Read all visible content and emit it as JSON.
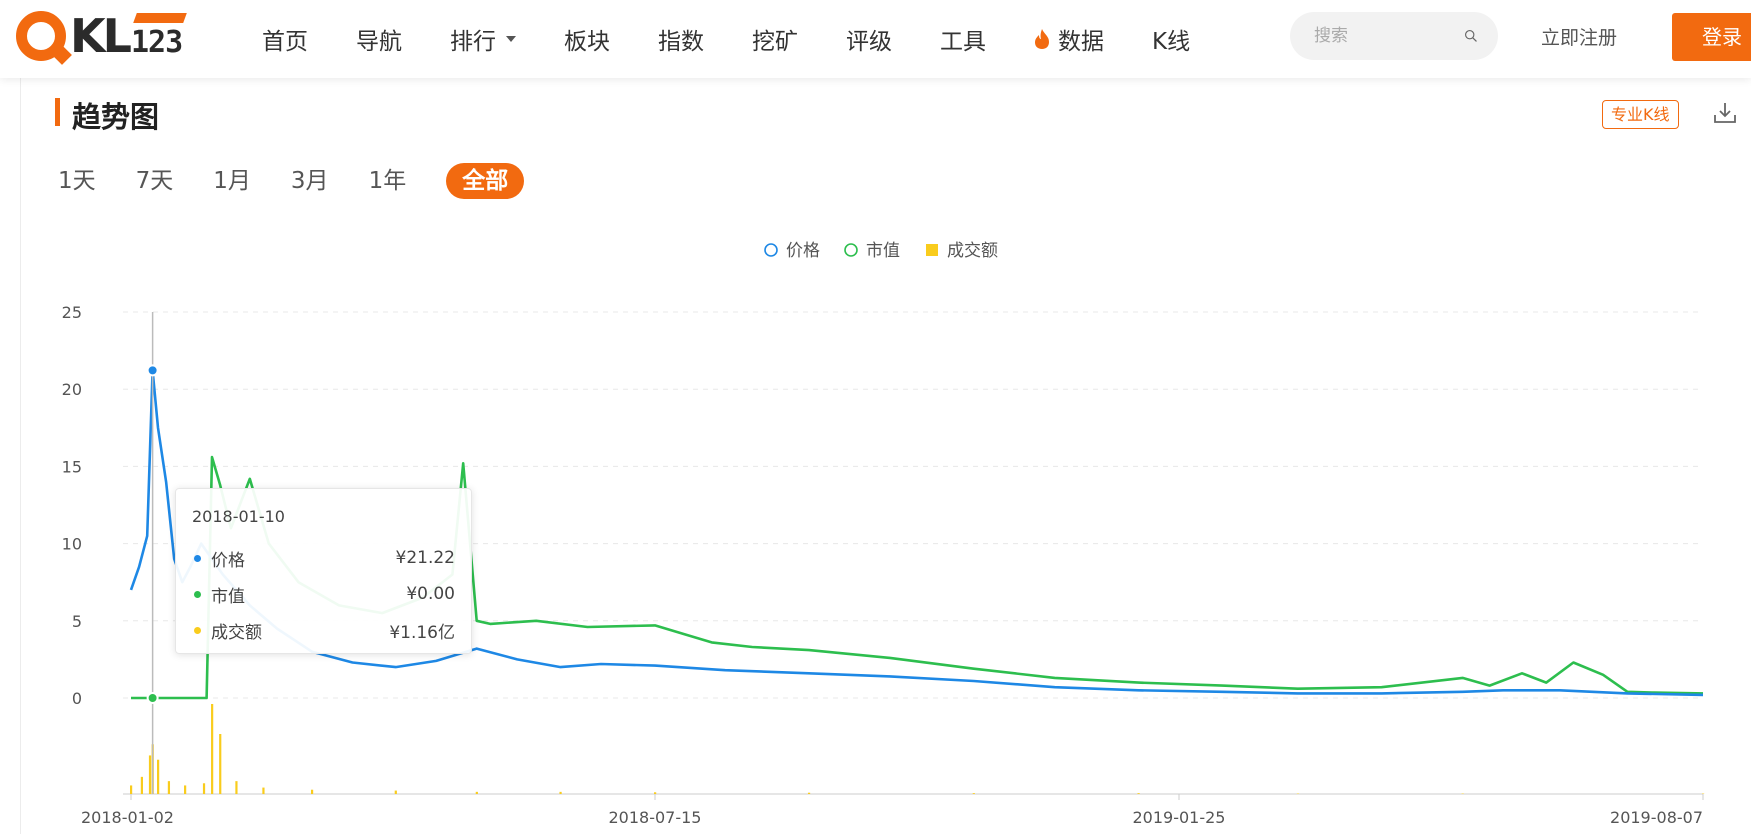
{
  "header": {
    "logo_letters": "KL",
    "logo_number": "123",
    "nav": [
      {
        "label": "首页"
      },
      {
        "label": "导航"
      },
      {
        "label": "排行",
        "dropdown": true
      },
      {
        "label": "板块"
      },
      {
        "label": "指数"
      },
      {
        "label": "挖矿"
      },
      {
        "label": "评级"
      },
      {
        "label": "工具"
      },
      {
        "label": "数据",
        "icon": "flame-icon"
      },
      {
        "label": "K线"
      }
    ],
    "search_placeholder": "搜索",
    "register": "立即注册",
    "login": "登录"
  },
  "section": {
    "title": "趋势图",
    "pro_kline": "专业K线",
    "ranges": [
      "1天",
      "7天",
      "1月",
      "3月",
      "1年",
      "全部"
    ],
    "active_range": "全部"
  },
  "tooltip": {
    "date": "2018-01-10",
    "rows": [
      {
        "name": "价格",
        "value": "¥21.22",
        "color": "#1e88e5"
      },
      {
        "name": "市值",
        "value": "¥0.00",
        "color": "#2dbe4e"
      },
      {
        "name": "成交额",
        "value": "¥1.16亿",
        "color": "#f9cc1d"
      }
    ]
  },
  "colors": {
    "accent": "#f26a10",
    "price": "#1e88e5",
    "mcap": "#2dbe4e",
    "volume": "#f9cc1d"
  },
  "chart_data": {
    "type": "line",
    "legend": [
      {
        "name": "价格",
        "marker": "circle",
        "color": "#1e88e5"
      },
      {
        "name": "市值",
        "marker": "circle",
        "color": "#2dbe4e"
      },
      {
        "name": "成交额",
        "marker": "square",
        "color": "#f9cc1d"
      }
    ],
    "legend_position": "top-center",
    "x_ticks": [
      "2018-01-02",
      "2018-07-15",
      "2019-01-25",
      "2019-08-07"
    ],
    "x_range": [
      "2018-01-02",
      "2019-08-07"
    ],
    "y_ticks": [
      0,
      5,
      10,
      15,
      20,
      25
    ],
    "ylim": [
      0,
      25
    ],
    "grid": "horizontal-dashed",
    "highlight_date": "2018-01-10",
    "series": [
      {
        "name": "价格",
        "x": [
          "2018-01-02",
          "2018-01-05",
          "2018-01-08",
          "2018-01-10",
          "2018-01-12",
          "2018-01-15",
          "2018-01-18",
          "2018-01-21",
          "2018-01-24",
          "2018-01-28",
          "2018-02-05",
          "2018-02-15",
          "2018-02-25",
          "2018-03-10",
          "2018-03-25",
          "2018-04-10",
          "2018-04-25",
          "2018-05-10",
          "2018-05-25",
          "2018-06-10",
          "2018-06-25",
          "2018-07-15",
          "2018-08-10",
          "2018-09-10",
          "2018-10-10",
          "2018-11-10",
          "2018-12-10",
          "2019-01-10",
          "2019-02-10",
          "2019-03-10",
          "2019-04-10",
          "2019-05-10",
          "2019-05-25",
          "2019-06-15",
          "2019-07-10",
          "2019-08-07"
        ],
        "values": [
          7.0,
          8.5,
          10.5,
          21.22,
          17.5,
          14.0,
          9.0,
          7.5,
          8.5,
          10.0,
          8.0,
          6.0,
          4.5,
          3.0,
          2.3,
          2.0,
          2.4,
          3.2,
          2.5,
          2.0,
          2.2,
          2.1,
          1.8,
          1.6,
          1.4,
          1.1,
          0.7,
          0.5,
          0.4,
          0.3,
          0.3,
          0.4,
          0.5,
          0.5,
          0.3,
          0.2
        ]
      },
      {
        "name": "市值",
        "x": [
          "2018-01-02",
          "2018-01-30",
          "2018-02-01",
          "2018-02-04",
          "2018-02-08",
          "2018-02-15",
          "2018-02-22",
          "2018-03-05",
          "2018-03-20",
          "2018-04-05",
          "2018-04-20",
          "2018-05-01",
          "2018-05-05",
          "2018-05-10",
          "2018-05-15",
          "2018-06-01",
          "2018-06-20",
          "2018-07-15",
          "2018-08-05",
          "2018-08-20",
          "2018-09-10",
          "2018-10-10",
          "2018-11-10",
          "2018-12-10",
          "2019-01-10",
          "2019-02-10",
          "2019-03-10",
          "2019-04-10",
          "2019-05-10",
          "2019-05-20",
          "2019-06-01",
          "2019-06-10",
          "2019-06-20",
          "2019-07-01",
          "2019-07-10",
          "2019-07-20",
          "2019-08-07"
        ],
        "values": [
          0,
          0,
          15.6,
          13.8,
          11.0,
          14.2,
          10.0,
          7.5,
          6.0,
          5.5,
          6.5,
          8.0,
          15.2,
          5.0,
          4.8,
          5.0,
          4.6,
          4.7,
          3.6,
          3.3,
          3.1,
          2.6,
          1.9,
          1.3,
          1.0,
          0.8,
          0.6,
          0.7,
          1.3,
          0.8,
          1.6,
          1.0,
          2.3,
          1.5,
          0.4,
          0.35,
          0.3
        ]
      },
      {
        "name": "成交额",
        "x": [
          "2018-01-02",
          "2018-01-06",
          "2018-01-09",
          "2018-01-10",
          "2018-01-12",
          "2018-01-16",
          "2018-01-22",
          "2018-01-29",
          "2018-02-01",
          "2018-02-04",
          "2018-02-10",
          "2018-02-20",
          "2018-03-10",
          "2018-04-10",
          "2018-05-10",
          "2018-06-10",
          "2018-07-15",
          "2018-09-10",
          "2018-11-10",
          "2019-01-10",
          "2019-03-10",
          "2019-05-10",
          "2019-08-07"
        ],
        "values": [
          0.2,
          0.4,
          0.9,
          1.16,
          0.8,
          0.3,
          0.2,
          0.25,
          2.1,
          1.4,
          0.3,
          0.15,
          0.1,
          0.08,
          0.05,
          0.05,
          0.04,
          0.03,
          0.02,
          0.02,
          0.01,
          0.01,
          0.01
        ]
      }
    ]
  }
}
